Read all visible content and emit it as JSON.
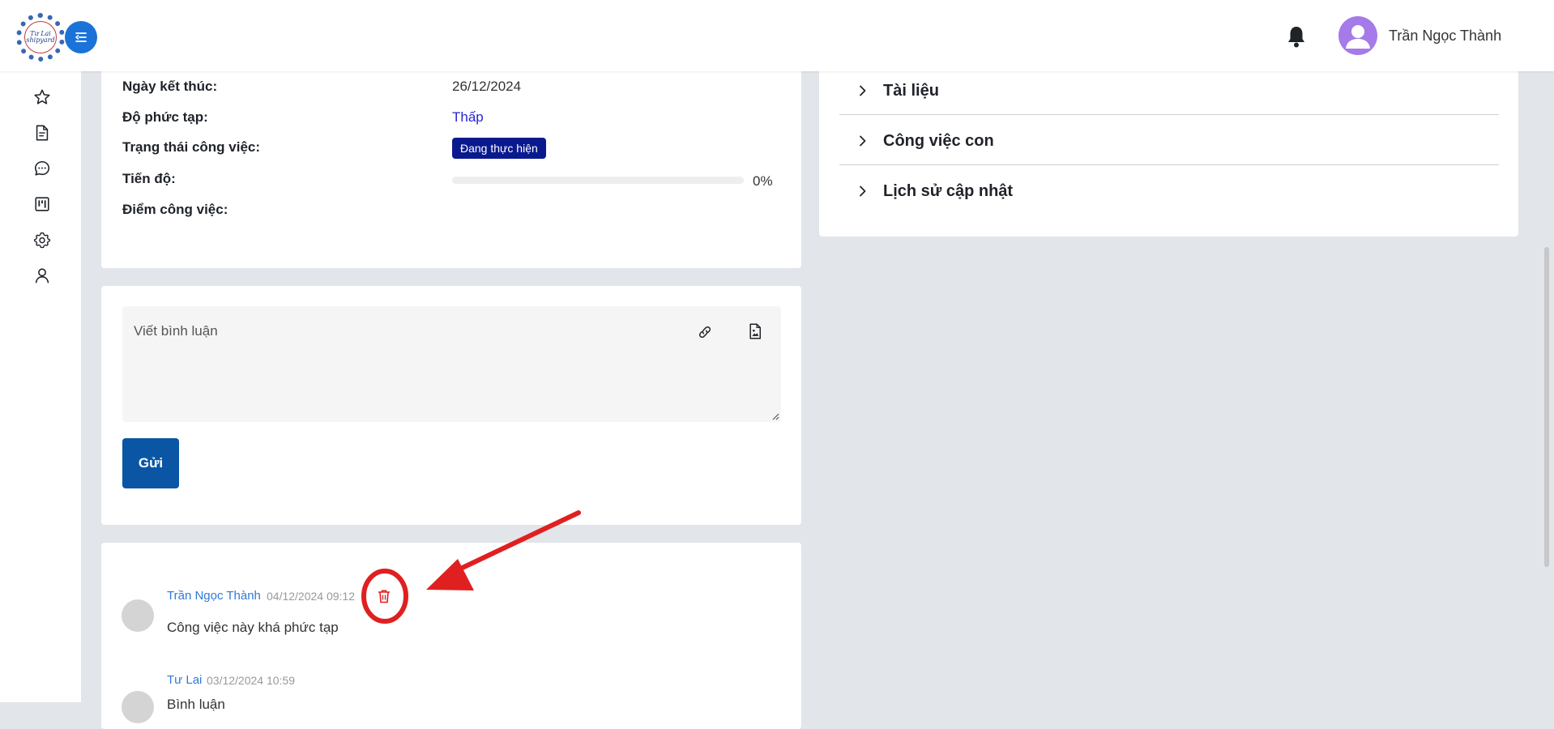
{
  "header": {
    "logo_text": "Tư Lai shipyard",
    "user_name": "Trần Ngọc Thành"
  },
  "sidebar": {
    "items": [
      {
        "icon": "star-icon"
      },
      {
        "icon": "document-icon"
      },
      {
        "icon": "chat-icon"
      },
      {
        "icon": "kanban-icon"
      },
      {
        "icon": "gear-icon"
      },
      {
        "icon": "user-icon"
      }
    ]
  },
  "task_info": {
    "end_date_label": "Ngày kết thúc:",
    "end_date_value": "26/12/2024",
    "complexity_label": "Độ phức tạp:",
    "complexity_value": "Thấp",
    "status_label": "Trạng thái công việc:",
    "status_value": "Đang thực hiện",
    "progress_label": "Tiến độ:",
    "progress_value": 0,
    "progress_text": "0%",
    "score_label": "Điểm công việc:"
  },
  "comment_form": {
    "placeholder": "Viết bình luận",
    "send_label": "Gửi"
  },
  "comments": [
    {
      "author": "Trần Ngọc Thành",
      "time": "04/12/2024 09:12",
      "text": "Công việc này khá phức tạp"
    },
    {
      "author": "Tư Lai",
      "time": "03/12/2024 10:59",
      "text": "Bình luận"
    }
  ],
  "right_panel": {
    "sections": [
      {
        "label": "Tài liệu"
      },
      {
        "label": "Công việc con"
      },
      {
        "label": "Lịch sử cập nhật"
      }
    ]
  },
  "colors": {
    "accent": "#1b72d8",
    "status_badge": "#0a1a8e",
    "send_button": "#0a56a4",
    "annotation": "#e02020"
  }
}
